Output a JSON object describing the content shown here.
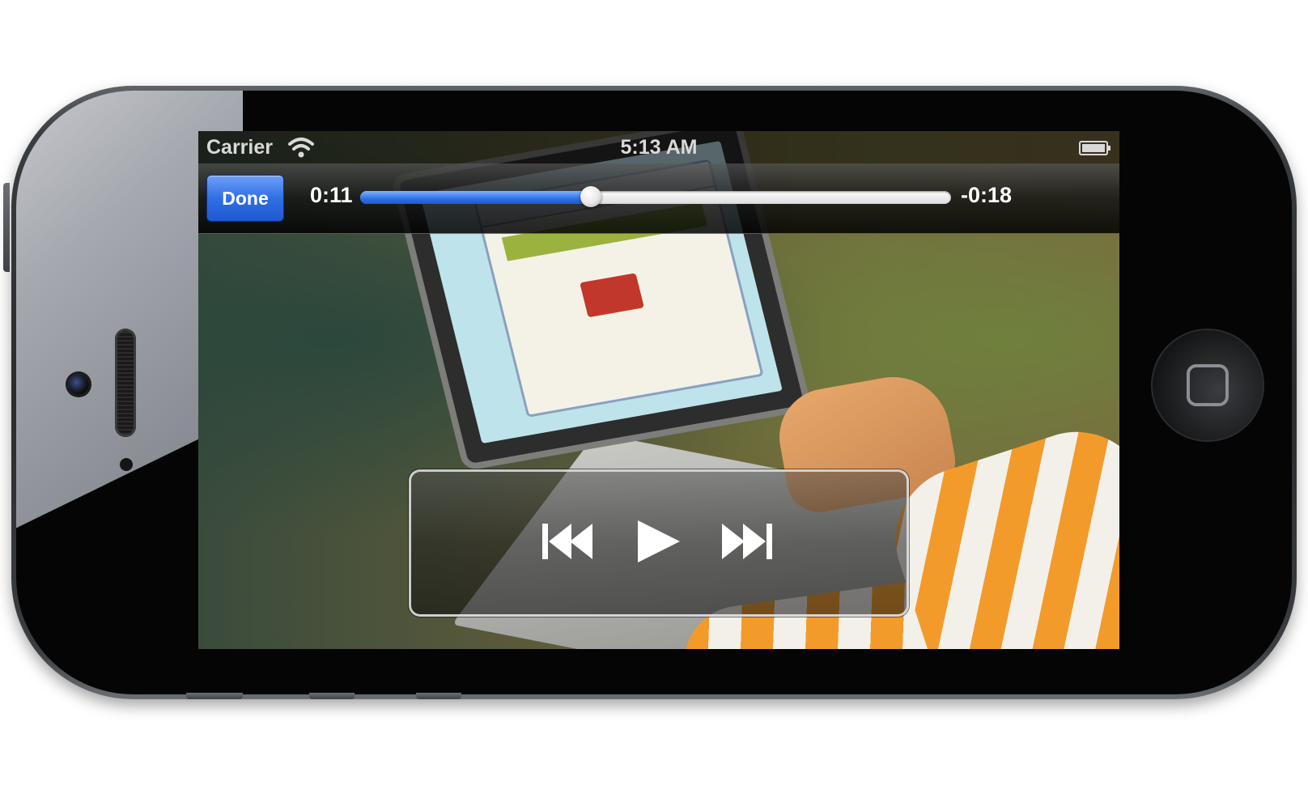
{
  "status_bar": {
    "carrier": "Carrier",
    "time": "5:13 AM",
    "wifi_icon": "wifi-icon",
    "battery_icon": "battery-icon"
  },
  "player": {
    "done_label": "Done",
    "elapsed": "0:11",
    "remaining": "-0:18",
    "progress_fraction": 0.39
  },
  "controls": {
    "previous_icon": "skip-back-icon",
    "play_icon": "play-icon",
    "next_icon": "skip-forward-icon"
  },
  "colors": {
    "accent": "#2f6fe6",
    "track": "#ffffff"
  }
}
